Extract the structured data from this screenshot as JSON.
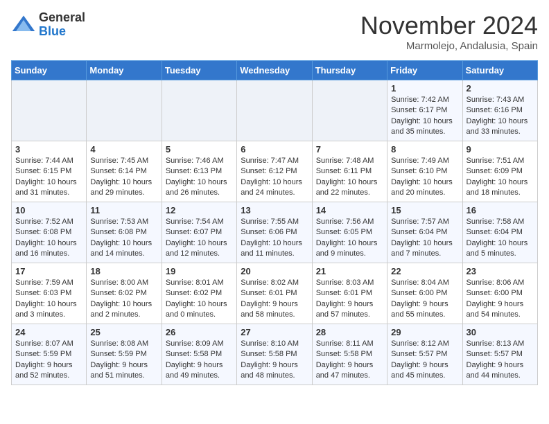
{
  "logo": {
    "general": "General",
    "blue": "Blue"
  },
  "title": "November 2024",
  "location": "Marmolejo, Andalusia, Spain",
  "weekdays": [
    "Sunday",
    "Monday",
    "Tuesday",
    "Wednesday",
    "Thursday",
    "Friday",
    "Saturday"
  ],
  "weeks": [
    [
      {
        "day": "",
        "info": ""
      },
      {
        "day": "",
        "info": ""
      },
      {
        "day": "",
        "info": ""
      },
      {
        "day": "",
        "info": ""
      },
      {
        "day": "",
        "info": ""
      },
      {
        "day": "1",
        "info": "Sunrise: 7:42 AM\nSunset: 6:17 PM\nDaylight: 10 hours\nand 35 minutes."
      },
      {
        "day": "2",
        "info": "Sunrise: 7:43 AM\nSunset: 6:16 PM\nDaylight: 10 hours\nand 33 minutes."
      }
    ],
    [
      {
        "day": "3",
        "info": "Sunrise: 7:44 AM\nSunset: 6:15 PM\nDaylight: 10 hours\nand 31 minutes."
      },
      {
        "day": "4",
        "info": "Sunrise: 7:45 AM\nSunset: 6:14 PM\nDaylight: 10 hours\nand 29 minutes."
      },
      {
        "day": "5",
        "info": "Sunrise: 7:46 AM\nSunset: 6:13 PM\nDaylight: 10 hours\nand 26 minutes."
      },
      {
        "day": "6",
        "info": "Sunrise: 7:47 AM\nSunset: 6:12 PM\nDaylight: 10 hours\nand 24 minutes."
      },
      {
        "day": "7",
        "info": "Sunrise: 7:48 AM\nSunset: 6:11 PM\nDaylight: 10 hours\nand 22 minutes."
      },
      {
        "day": "8",
        "info": "Sunrise: 7:49 AM\nSunset: 6:10 PM\nDaylight: 10 hours\nand 20 minutes."
      },
      {
        "day": "9",
        "info": "Sunrise: 7:51 AM\nSunset: 6:09 PM\nDaylight: 10 hours\nand 18 minutes."
      }
    ],
    [
      {
        "day": "10",
        "info": "Sunrise: 7:52 AM\nSunset: 6:08 PM\nDaylight: 10 hours\nand 16 minutes."
      },
      {
        "day": "11",
        "info": "Sunrise: 7:53 AM\nSunset: 6:08 PM\nDaylight: 10 hours\nand 14 minutes."
      },
      {
        "day": "12",
        "info": "Sunrise: 7:54 AM\nSunset: 6:07 PM\nDaylight: 10 hours\nand 12 minutes."
      },
      {
        "day": "13",
        "info": "Sunrise: 7:55 AM\nSunset: 6:06 PM\nDaylight: 10 hours\nand 11 minutes."
      },
      {
        "day": "14",
        "info": "Sunrise: 7:56 AM\nSunset: 6:05 PM\nDaylight: 10 hours\nand 9 minutes."
      },
      {
        "day": "15",
        "info": "Sunrise: 7:57 AM\nSunset: 6:04 PM\nDaylight: 10 hours\nand 7 minutes."
      },
      {
        "day": "16",
        "info": "Sunrise: 7:58 AM\nSunset: 6:04 PM\nDaylight: 10 hours\nand 5 minutes."
      }
    ],
    [
      {
        "day": "17",
        "info": "Sunrise: 7:59 AM\nSunset: 6:03 PM\nDaylight: 10 hours\nand 3 minutes."
      },
      {
        "day": "18",
        "info": "Sunrise: 8:00 AM\nSunset: 6:02 PM\nDaylight: 10 hours\nand 2 minutes."
      },
      {
        "day": "19",
        "info": "Sunrise: 8:01 AM\nSunset: 6:02 PM\nDaylight: 10 hours\nand 0 minutes."
      },
      {
        "day": "20",
        "info": "Sunrise: 8:02 AM\nSunset: 6:01 PM\nDaylight: 9 hours\nand 58 minutes."
      },
      {
        "day": "21",
        "info": "Sunrise: 8:03 AM\nSunset: 6:01 PM\nDaylight: 9 hours\nand 57 minutes."
      },
      {
        "day": "22",
        "info": "Sunrise: 8:04 AM\nSunset: 6:00 PM\nDaylight: 9 hours\nand 55 minutes."
      },
      {
        "day": "23",
        "info": "Sunrise: 8:06 AM\nSunset: 6:00 PM\nDaylight: 9 hours\nand 54 minutes."
      }
    ],
    [
      {
        "day": "24",
        "info": "Sunrise: 8:07 AM\nSunset: 5:59 PM\nDaylight: 9 hours\nand 52 minutes."
      },
      {
        "day": "25",
        "info": "Sunrise: 8:08 AM\nSunset: 5:59 PM\nDaylight: 9 hours\nand 51 minutes."
      },
      {
        "day": "26",
        "info": "Sunrise: 8:09 AM\nSunset: 5:58 PM\nDaylight: 9 hours\nand 49 minutes."
      },
      {
        "day": "27",
        "info": "Sunrise: 8:10 AM\nSunset: 5:58 PM\nDaylight: 9 hours\nand 48 minutes."
      },
      {
        "day": "28",
        "info": "Sunrise: 8:11 AM\nSunset: 5:58 PM\nDaylight: 9 hours\nand 47 minutes."
      },
      {
        "day": "29",
        "info": "Sunrise: 8:12 AM\nSunset: 5:57 PM\nDaylight: 9 hours\nand 45 minutes."
      },
      {
        "day": "30",
        "info": "Sunrise: 8:13 AM\nSunset: 5:57 PM\nDaylight: 9 hours\nand 44 minutes."
      }
    ]
  ]
}
